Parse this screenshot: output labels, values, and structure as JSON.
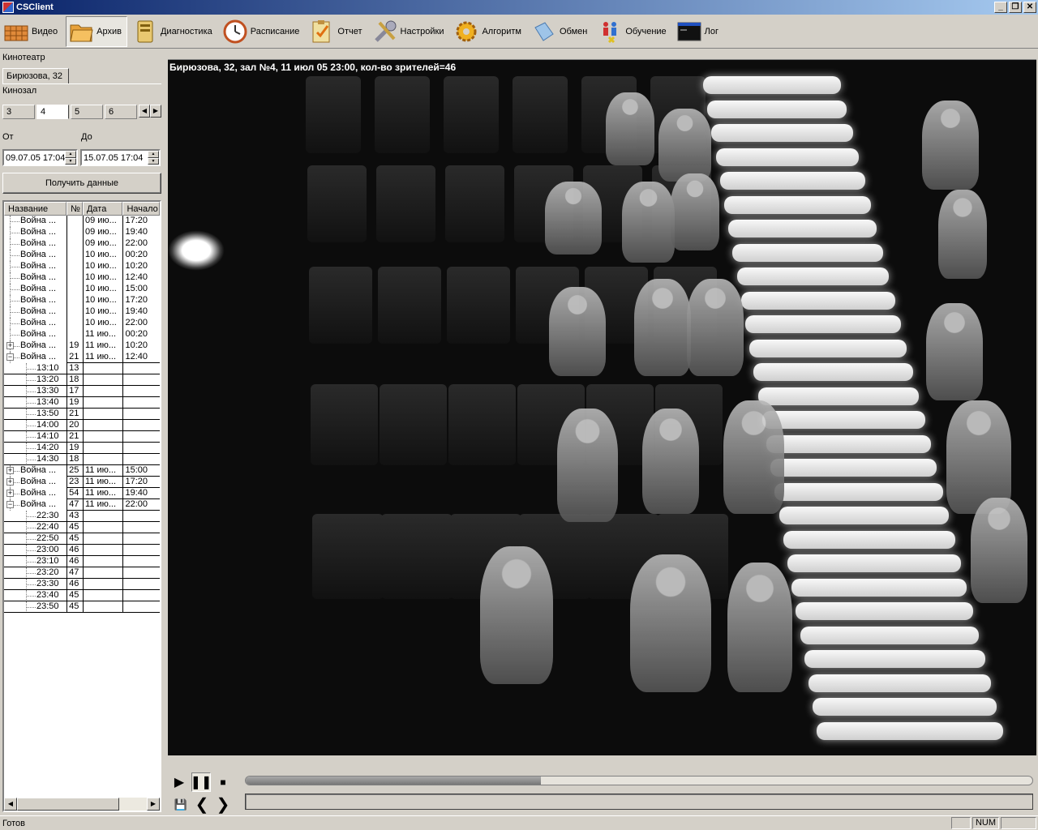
{
  "window": {
    "title": "CSClient"
  },
  "toolbar": [
    {
      "label": "Видео",
      "icon": "video-icon"
    },
    {
      "label": "Архив",
      "icon": "archive-folder-icon",
      "active": true
    },
    {
      "label": "Диагностика",
      "icon": "diagnostics-icon"
    },
    {
      "label": "Расписание",
      "icon": "clock-icon"
    },
    {
      "label": "Отчет",
      "icon": "report-clipboard-icon"
    },
    {
      "label": "Настройки",
      "icon": "wrench-icon"
    },
    {
      "label": "Алгоритм",
      "icon": "gear-icon"
    },
    {
      "label": "Обмен",
      "icon": "exchange-icon"
    },
    {
      "label": "Обучение",
      "icon": "training-figures-icon"
    },
    {
      "label": "Лог",
      "icon": "log-console-icon"
    }
  ],
  "left": {
    "cinema_label": "Кинотеатр",
    "cinema_tab": "Бирюзова, 32",
    "hall_label": "Кинозал",
    "hall_tabs": [
      "3",
      "4",
      "5",
      "6"
    ],
    "hall_selected": "4",
    "from_label": "От",
    "to_label": "До",
    "from_value": "09.07.05 17:04",
    "to_value": "15.07.05 17:04",
    "get_button": "Получить данные",
    "columns": [
      "Название",
      "№",
      "Дата",
      "Начало"
    ],
    "rows": [
      {
        "level": 0,
        "exp": "",
        "name": "Война ...",
        "num": "",
        "date": "09 ию...",
        "start": "17:20"
      },
      {
        "level": 0,
        "exp": "",
        "name": "Война ...",
        "num": "",
        "date": "09 ию...",
        "start": "19:40"
      },
      {
        "level": 0,
        "exp": "",
        "name": "Война ...",
        "num": "",
        "date": "09 ию...",
        "start": "22:00"
      },
      {
        "level": 0,
        "exp": "",
        "name": "Война ...",
        "num": "",
        "date": "10 ию...",
        "start": "00:20"
      },
      {
        "level": 0,
        "exp": "",
        "name": "Война ...",
        "num": "",
        "date": "10 ию...",
        "start": "10:20"
      },
      {
        "level": 0,
        "exp": "",
        "name": "Война ...",
        "num": "",
        "date": "10 ию...",
        "start": "12:40"
      },
      {
        "level": 0,
        "exp": "",
        "name": "Война ...",
        "num": "",
        "date": "10 ию...",
        "start": "15:00"
      },
      {
        "level": 0,
        "exp": "",
        "name": "Война ...",
        "num": "",
        "date": "10 ию...",
        "start": "17:20"
      },
      {
        "level": 0,
        "exp": "",
        "name": "Война ...",
        "num": "",
        "date": "10 ию...",
        "start": "19:40"
      },
      {
        "level": 0,
        "exp": "",
        "name": "Война ...",
        "num": "",
        "date": "10 ию...",
        "start": "22:00"
      },
      {
        "level": 0,
        "exp": "",
        "name": "Война ...",
        "num": "",
        "date": "11 ию...",
        "start": "00:20"
      },
      {
        "level": 0,
        "exp": "+",
        "name": "Война ...",
        "num": "19",
        "date": "11 ию...",
        "start": "10:20"
      },
      {
        "level": 0,
        "exp": "-",
        "name": "Война ...",
        "num": "21",
        "date": "11 ию...",
        "start": "12:40"
      },
      {
        "level": 1,
        "exp": "",
        "name": "13:10",
        "num": "13",
        "date": "",
        "start": ""
      },
      {
        "level": 1,
        "exp": "",
        "name": "13:20",
        "num": "18",
        "date": "",
        "start": ""
      },
      {
        "level": 1,
        "exp": "",
        "name": "13:30",
        "num": "17",
        "date": "",
        "start": ""
      },
      {
        "level": 1,
        "exp": "",
        "name": "13:40",
        "num": "19",
        "date": "",
        "start": ""
      },
      {
        "level": 1,
        "exp": "",
        "name": "13:50",
        "num": "21",
        "date": "",
        "start": ""
      },
      {
        "level": 1,
        "exp": "",
        "name": "14:00",
        "num": "20",
        "date": "",
        "start": ""
      },
      {
        "level": 1,
        "exp": "",
        "name": "14:10",
        "num": "21",
        "date": "",
        "start": ""
      },
      {
        "level": 1,
        "exp": "",
        "name": "14:20",
        "num": "19",
        "date": "",
        "start": ""
      },
      {
        "level": 1,
        "exp": "",
        "name": "14:30",
        "num": "18",
        "date": "",
        "start": ""
      },
      {
        "level": 0,
        "exp": "+",
        "name": "Война ...",
        "num": "25",
        "date": "11 ию...",
        "start": "15:00"
      },
      {
        "level": 0,
        "exp": "+",
        "name": "Война ...",
        "num": "23",
        "date": "11 ию...",
        "start": "17:20"
      },
      {
        "level": 0,
        "exp": "+",
        "name": "Война ...",
        "num": "54",
        "date": "11 ию...",
        "start": "19:40"
      },
      {
        "level": 0,
        "exp": "-",
        "name": "Война ...",
        "num": "47",
        "date": "11 ию...",
        "start": "22:00"
      },
      {
        "level": 1,
        "exp": "",
        "name": "22:30",
        "num": "43",
        "date": "",
        "start": ""
      },
      {
        "level": 1,
        "exp": "",
        "name": "22:40",
        "num": "45",
        "date": "",
        "start": ""
      },
      {
        "level": 1,
        "exp": "",
        "name": "22:50",
        "num": "45",
        "date": "",
        "start": ""
      },
      {
        "level": 1,
        "exp": "",
        "name": "23:00",
        "num": "46",
        "date": "",
        "start": ""
      },
      {
        "level": 1,
        "exp": "",
        "name": "23:10",
        "num": "46",
        "date": "",
        "start": ""
      },
      {
        "level": 1,
        "exp": "",
        "name": "23:20",
        "num": "47",
        "date": "",
        "start": ""
      },
      {
        "level": 1,
        "exp": "",
        "name": "23:30",
        "num": "46",
        "date": "",
        "start": ""
      },
      {
        "level": 1,
        "exp": "",
        "name": "23:40",
        "num": "45",
        "date": "",
        "start": ""
      },
      {
        "level": 1,
        "exp": "",
        "name": "23:50",
        "num": "45",
        "date": "",
        "start": ""
      }
    ]
  },
  "video": {
    "caption": "Бирюзова, 32, зал №4, 11 июл 05 23:00, кол-во зрителей=46"
  },
  "player": {
    "progress": 0.375
  },
  "status": {
    "message": "Готов",
    "num": "NUM"
  }
}
